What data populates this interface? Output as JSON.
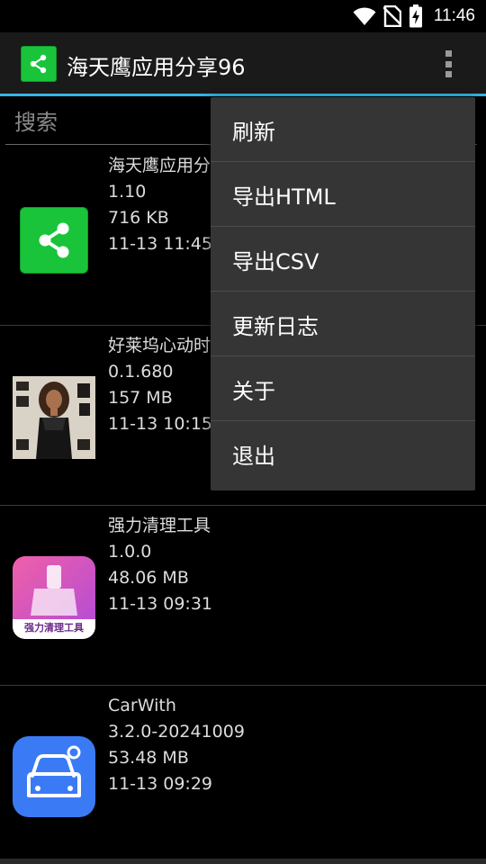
{
  "status_bar": {
    "time": "11:46",
    "icons": [
      "wifi-icon",
      "no-sim-icon",
      "battery-charging-icon"
    ]
  },
  "app_bar": {
    "title": "海天鹰应用分享96",
    "icon": "share-icon",
    "overflow_icon": "more-vert-icon"
  },
  "search": {
    "placeholder": "搜索",
    "value": ""
  },
  "apps": [
    {
      "name": "海天鹰应用分",
      "version": "1.10",
      "size": "716 KB",
      "date": "11-13 11:45",
      "icon": "share-app-icon"
    },
    {
      "name": "好莱坞心动时",
      "version": "0.1.680",
      "size": "157 MB",
      "date": "11-13 10:15",
      "icon": "hollywood-game-icon"
    },
    {
      "name": "强力清理工具",
      "version": "1.0.0",
      "size": "48.06 MB",
      "date": "11-13 09:31",
      "icon": "cleaner-app-icon",
      "icon_text": "强力清理工具"
    },
    {
      "name": "CarWith",
      "version": "3.2.0-20241009",
      "size": "53.48 MB",
      "date": "11-13 09:29",
      "icon": "carwith-app-icon"
    }
  ],
  "menu": {
    "items": [
      "刷新",
      "导出HTML",
      "导出CSV",
      "更新日志",
      "关于",
      "退出"
    ]
  },
  "colors": {
    "accent": "#33b5e5",
    "share_green": "#19c43a",
    "carwith_blue": "#3a7bf5",
    "cleaner_pink": "#e0409a",
    "menu_bg": "#353535"
  }
}
